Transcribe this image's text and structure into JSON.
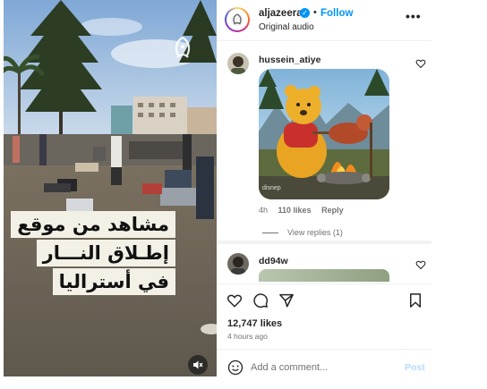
{
  "video": {
    "watermark_icon": "aljazeera-logo-icon",
    "caption_lines": [
      "مشاهد من موقع",
      "إطـلاق النـــار",
      "في أستراليا"
    ],
    "mute_icon": "speaker-muted-icon"
  },
  "header": {
    "username": "aljazeera",
    "verified_icon": "verified-badge-icon",
    "separator": "•",
    "follow_label": "Follow",
    "audio_label": "Original audio",
    "more_icon": "more-options-icon"
  },
  "comments": [
    {
      "username": "hussein_atiye",
      "image_icon": "winnie-the-pooh-campfire-image",
      "image_watermark": "disnep",
      "time": "4h",
      "likes": "110 likes",
      "reply_label": "Reply",
      "view_replies": "View replies (1)"
    },
    {
      "username": "dd94w"
    }
  ],
  "actions": {
    "like_icon": "heart-icon",
    "comment_icon": "comment-icon",
    "share_icon": "send-icon",
    "save_icon": "bookmark-icon"
  },
  "stats": {
    "likes": "12,747 likes",
    "time_ago": "4 hours ago"
  },
  "comment_box": {
    "emoji_icon": "emoji-icon",
    "placeholder": "Add a comment...",
    "post_label": "Post"
  },
  "colors": {
    "link_blue": "#0095f6",
    "post_disabled": "#b3dbff",
    "muted_text": "#737373",
    "caption_bg": "#f3f0e6"
  }
}
